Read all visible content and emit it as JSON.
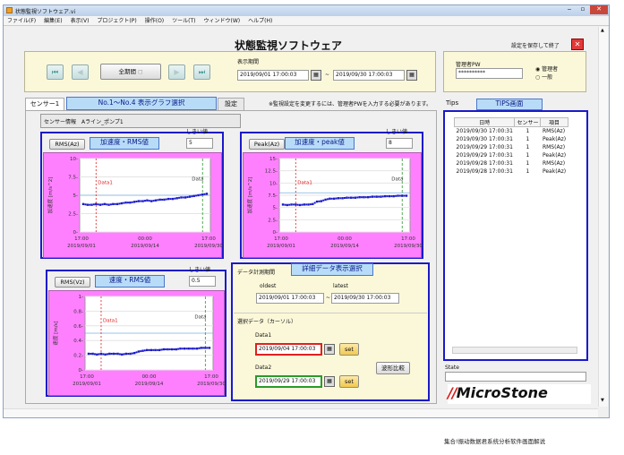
{
  "window": {
    "title": "状態監視ソフトウェア.vi"
  },
  "menu": [
    "ファイル(F)",
    "編集(E)",
    "表示(V)",
    "プロジェクト(P)",
    "操作(O)",
    "ツール(T)",
    "ウィンドウ(W)",
    "ヘルプ(H)"
  ],
  "app_title": "状態監視ソフトウェア",
  "save_exit_label": "設定を保存して終了",
  "nav": {
    "all_period_label": "全期間"
  },
  "display_period": {
    "label": "表示期間",
    "start": "2019/09/01 17:00:03",
    "end": "2019/09/30 17:00:03",
    "sep": "~"
  },
  "admin": {
    "label": "管理者PW",
    "value": "**********",
    "options": [
      "管理者",
      "一般"
    ],
    "selected": "管理者"
  },
  "tabs": [
    "センサー1",
    "4",
    "設定"
  ],
  "tab_notice": "※監視設定を変更するには、管理者PWを入力する必要があります。",
  "tips_tab": "Tips",
  "sensor_info": {
    "label": "センサー情報",
    "value": "Aライン_ポンプ1"
  },
  "annotations": {
    "tab_select": "No.1～No.4 表示グラフ選択",
    "accel_rms": "加速度・RMS値",
    "accel_peak": "加速度・peak値",
    "vel_rms": "速度・RMS値",
    "detail": "詳細データ表示選択",
    "tips": "TIPS画面"
  },
  "charts": [
    {
      "select": "RMS(Az)",
      "threshold_label": "しきい値",
      "threshold": "5",
      "ylabel": "加速度 [m/s^2]",
      "data1_label": "Data1",
      "data2_label": "Data",
      "xticks": [
        "17:00\n2019/09/01",
        "00:00\n2019/09/14",
        "17:00\n2019/09/30"
      ]
    },
    {
      "select": "Peak(Az)",
      "threshold_label": "しきい値",
      "threshold": "8",
      "ylabel": "加速度 [m/s^2]",
      "data1_label": "Data1",
      "data2_label": "Data",
      "xticks": [
        "17:00\n2019/09/01",
        "00:00\n2019/09/14",
        "17:00\n2019/09/30"
      ]
    },
    {
      "select": "RMS(Vz)",
      "threshold_label": "しきい値",
      "threshold": "0.5",
      "ylabel": "速度 [m/s]",
      "data1_label": "Data1",
      "data2_label": "Data",
      "xticks": [
        "17:00\n2019/09/01",
        "00:00\n2019/09/14",
        "17:00\n2019/09/30"
      ]
    }
  ],
  "chart_data": [
    {
      "type": "scatter",
      "title": "",
      "ylabel": "加速度 [m/s^2]",
      "ylim": [
        0,
        10
      ],
      "yticks": [
        "0-",
        "2.5-",
        "5-",
        "7.5-",
        "10-"
      ],
      "xticks": [
        "17:00 2019/09/01",
        "00:00 2019/09/14",
        "17:00 2019/09/30"
      ],
      "threshold": 5,
      "x": [
        0,
        1,
        2,
        3,
        4,
        5,
        6,
        7,
        8,
        9,
        10,
        11,
        12,
        13,
        14,
        15,
        16,
        17,
        18,
        19,
        20,
        21,
        22,
        23,
        24,
        25,
        26,
        27,
        28,
        29
      ],
      "y": [
        3.8,
        3.7,
        3.7,
        3.8,
        3.7,
        3.8,
        3.7,
        3.8,
        3.8,
        3.9,
        4.0,
        4.0,
        4.1,
        4.2,
        4.2,
        4.3,
        4.2,
        4.3,
        4.4,
        4.4,
        4.5,
        4.5,
        4.6,
        4.7,
        4.7,
        4.8,
        4.9,
        5.0,
        5.1,
        5.2
      ]
    },
    {
      "type": "scatter",
      "title": "",
      "ylabel": "加速度 [m/s^2]",
      "ylim": [
        0,
        15
      ],
      "yticks": [
        "0-",
        "2.5-",
        "5-",
        "7.5-",
        "10-",
        "12.5-",
        "15-"
      ],
      "xticks": [
        "17:00 2019/09/01",
        "00:00 2019/09/14",
        "17:00 2019/09/30"
      ],
      "threshold": 8,
      "x": [
        0,
        1,
        2,
        3,
        4,
        5,
        6,
        7,
        8,
        9,
        10,
        11,
        12,
        13,
        14,
        15,
        16,
        17,
        18,
        19,
        20,
        21,
        22,
        23,
        24,
        25,
        26,
        27,
        28,
        29
      ],
      "y": [
        5.6,
        5.5,
        5.6,
        5.6,
        5.5,
        5.6,
        5.6,
        5.7,
        6.2,
        6.3,
        6.6,
        6.8,
        6.8,
        6.9,
        6.9,
        7.0,
        7.0,
        7.0,
        7.1,
        7.1,
        7.1,
        7.2,
        7.2,
        7.2,
        7.3,
        7.3,
        7.3,
        7.4,
        7.4,
        7.4
      ]
    },
    {
      "type": "scatter",
      "title": "",
      "ylabel": "速度 [m/s]",
      "ylim": [
        0,
        1
      ],
      "yticks": [
        "0-",
        "0.2-",
        "0.4-",
        "0.6-",
        "0.8-",
        "1-"
      ],
      "xticks": [
        "17:00 2019/09/01",
        "00:00 2019/09/14",
        "17:00 2019/09/30"
      ],
      "threshold": 0.5,
      "x": [
        0,
        1,
        2,
        3,
        4,
        5,
        6,
        7,
        8,
        9,
        10,
        11,
        12,
        13,
        14,
        15,
        16,
        17,
        18,
        19,
        20,
        21,
        22,
        23,
        24,
        25,
        26,
        27,
        28,
        29
      ],
      "y": [
        0.22,
        0.22,
        0.21,
        0.22,
        0.21,
        0.22,
        0.22,
        0.22,
        0.21,
        0.22,
        0.22,
        0.23,
        0.25,
        0.26,
        0.27,
        0.27,
        0.27,
        0.27,
        0.28,
        0.28,
        0.28,
        0.28,
        0.29,
        0.29,
        0.29,
        0.29,
        0.29,
        0.3,
        0.3,
        0.3
      ]
    }
  ],
  "detail_panel": {
    "title": "データ計測期間",
    "oldest_label": "oldest",
    "latest_label": "latest",
    "oldest": "2019/09/01 17:00:03",
    "latest": "2019/09/30 17:00:03",
    "sep": "~",
    "cursor_title": "選択データ（カーソル）",
    "data1_label": "Data1",
    "data1": "2019/09/04 17:00:03",
    "data2_label": "Data2",
    "data2": "2019/09/29 17:00:03",
    "set_label": "set",
    "compare_label": "波形比較"
  },
  "tips": {
    "headers": [
      "日時",
      "センサー",
      "項目"
    ],
    "rows": [
      [
        "2019/09/30 17:00:31",
        "1",
        "RMS(Az)"
      ],
      [
        "2019/09/30 17:00:31",
        "1",
        "Peak(Az)"
      ],
      [
        "2019/09/29 17:00:31",
        "1",
        "RMS(Az)"
      ],
      [
        "2019/09/29 17:00:31",
        "1",
        "Peak(Az)"
      ],
      [
        "2019/09/28 17:00:31",
        "1",
        "RMS(Az)"
      ],
      [
        "2019/09/28 17:00:31",
        "1",
        "Peak(Az)"
      ]
    ],
    "state_label": "State"
  },
  "logo": "MicroStone",
  "caption": "集合!振动数据君系统分析软件画面解说",
  "colors": {
    "highlight": "#1a1acb",
    "chart_bg": "#ff80ff",
    "points": "#1a1acb",
    "threshold": "#7ab0e0",
    "data1": "#e02020",
    "data2": "#2a9a2a"
  }
}
